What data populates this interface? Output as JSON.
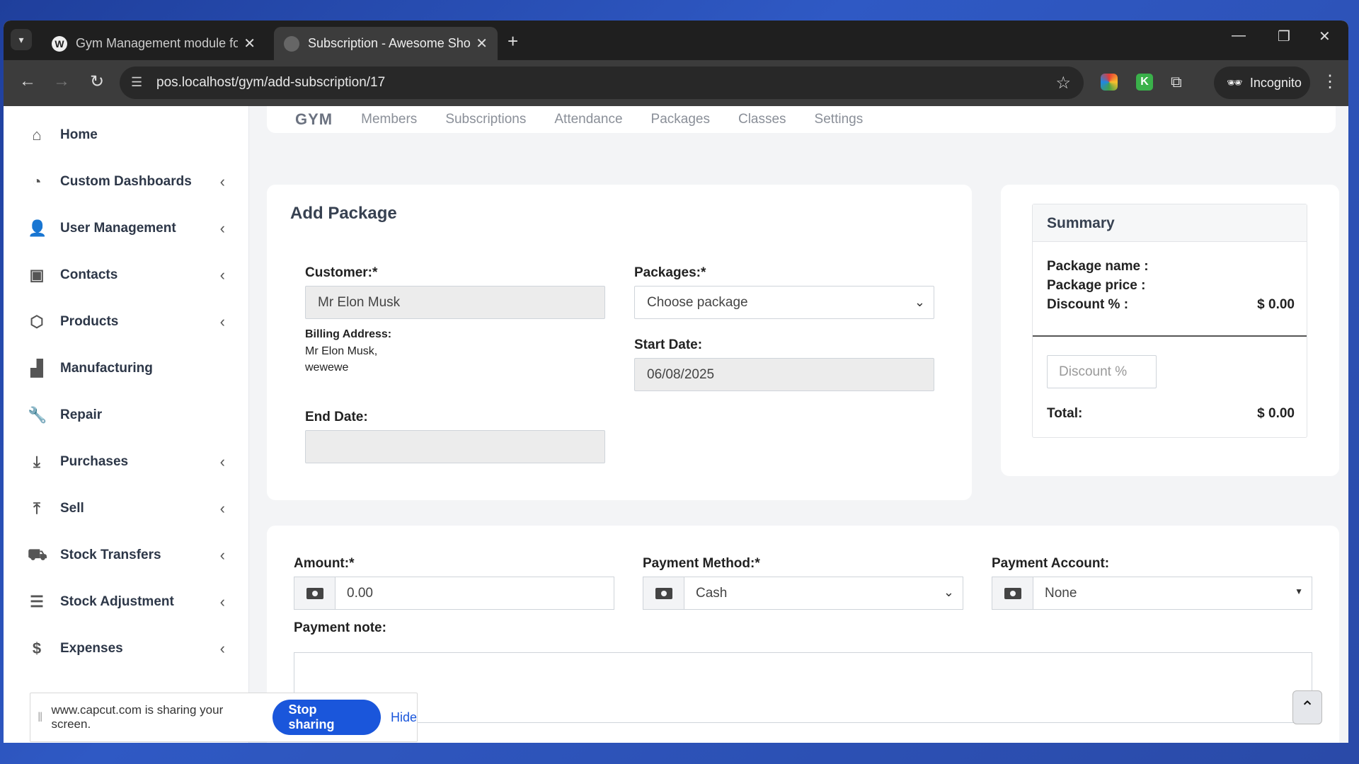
{
  "browser": {
    "tabs": [
      {
        "title": "Gym Management module for Ultimate",
        "favicon": "wordpress-icon"
      },
      {
        "title": "Subscription - Awesome Shop",
        "favicon": "globe-icon"
      }
    ],
    "url": "pos.localhost/gym/add-subscription/17",
    "incognito_label": "Incognito"
  },
  "sidebar": {
    "items": [
      {
        "label": "Home",
        "icon": "home-icon",
        "has_chevron": false
      },
      {
        "label": "Custom Dashboards",
        "icon": "dashboard-icon",
        "has_chevron": true
      },
      {
        "label": "User Management",
        "icon": "users-icon",
        "has_chevron": true
      },
      {
        "label": "Contacts",
        "icon": "contacts-icon",
        "has_chevron": true
      },
      {
        "label": "Products",
        "icon": "box-icon",
        "has_chevron": true
      },
      {
        "label": "Manufacturing",
        "icon": "factory-icon",
        "has_chevron": false
      },
      {
        "label": "Repair",
        "icon": "wrench-icon",
        "has_chevron": false
      },
      {
        "label": "Purchases",
        "icon": "download-icon",
        "has_chevron": true
      },
      {
        "label": "Sell",
        "icon": "upload-icon",
        "has_chevron": true
      },
      {
        "label": "Stock Transfers",
        "icon": "truck-icon",
        "has_chevron": true
      },
      {
        "label": "Stock Adjustment",
        "icon": "database-icon",
        "has_chevron": true
      },
      {
        "label": "Expenses",
        "icon": "receipt-icon",
        "has_chevron": true
      }
    ]
  },
  "topnav": {
    "brand": "GYM",
    "links": [
      "Members",
      "Subscriptions",
      "Attendance",
      "Packages",
      "Classes",
      "Settings"
    ]
  },
  "add_package": {
    "title": "Add Package",
    "customer_label": "Customer:*",
    "customer_value": "Mr Elon Musk",
    "packages_label": "Packages:*",
    "packages_placeholder": "Choose package",
    "billing_label": "Billing Address:",
    "billing_line1": "Mr Elon Musk,",
    "billing_line2": "wewewe",
    "start_date_label": "Start Date:",
    "start_date_value": "06/08/2025",
    "end_date_label": "End Date:",
    "end_date_value": ""
  },
  "summary": {
    "title": "Summary",
    "package_name_label": "Package name :",
    "package_name_value": "",
    "package_price_label": "Package price :",
    "package_price_value": "",
    "discount_label": "Discount % :",
    "discount_value": "$ 0.00",
    "discount_placeholder": "Discount %",
    "total_label": "Total:",
    "total_value": "$ 0.00"
  },
  "payment": {
    "amount_label": "Amount:*",
    "amount_value": "0.00",
    "method_label": "Payment Method:*",
    "method_value": "Cash",
    "account_label": "Payment Account:",
    "account_value": "None",
    "note_label": "Payment note:"
  },
  "share_bar": {
    "message": "www.capcut.com is sharing your screen.",
    "stop_label": "Stop sharing",
    "hide_label": "Hide"
  }
}
